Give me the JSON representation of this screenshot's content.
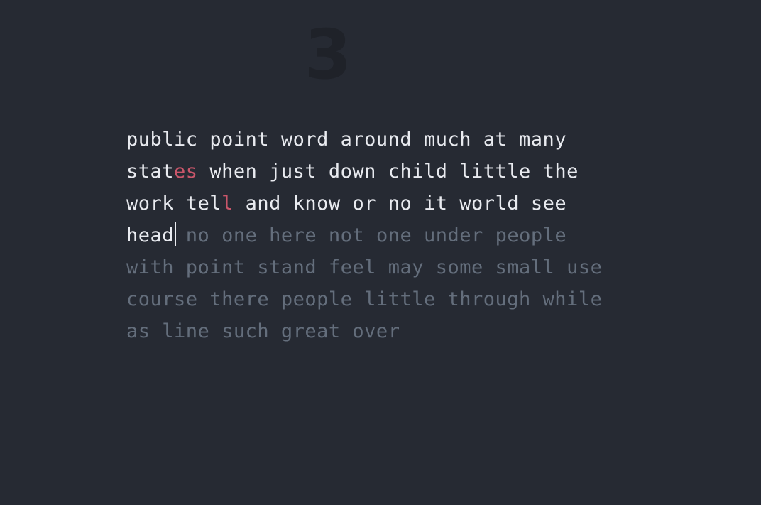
{
  "timer": {
    "value": "3"
  },
  "lines": [
    [
      {
        "parts": [
          {
            "t": "public",
            "s": "done"
          }
        ]
      },
      {
        "parts": [
          {
            "t": "point",
            "s": "done"
          }
        ]
      },
      {
        "parts": [
          {
            "t": "word",
            "s": "done"
          }
        ]
      },
      {
        "parts": [
          {
            "t": "around",
            "s": "done"
          }
        ]
      },
      {
        "parts": [
          {
            "t": "much",
            "s": "done"
          }
        ]
      },
      {
        "parts": [
          {
            "t": "at",
            "s": "done"
          }
        ]
      },
      {
        "parts": [
          {
            "t": "many",
            "s": "done"
          }
        ]
      }
    ],
    [
      {
        "parts": [
          {
            "t": "stat",
            "s": "done"
          },
          {
            "t": "es",
            "s": "err"
          }
        ]
      },
      {
        "parts": [
          {
            "t": "when",
            "s": "done"
          }
        ]
      },
      {
        "parts": [
          {
            "t": "just",
            "s": "done"
          }
        ]
      },
      {
        "parts": [
          {
            "t": "down",
            "s": "done"
          }
        ]
      },
      {
        "parts": [
          {
            "t": "child",
            "s": "done"
          }
        ]
      },
      {
        "parts": [
          {
            "t": "little",
            "s": "done"
          }
        ]
      },
      {
        "parts": [
          {
            "t": "the",
            "s": "done"
          }
        ]
      }
    ],
    [
      {
        "parts": [
          {
            "t": "work",
            "s": "done"
          }
        ]
      },
      {
        "parts": [
          {
            "t": "tel",
            "s": "done"
          },
          {
            "t": "l",
            "s": "err"
          }
        ]
      },
      {
        "parts": [
          {
            "t": "and",
            "s": "done"
          }
        ]
      },
      {
        "parts": [
          {
            "t": "know",
            "s": "done"
          }
        ]
      },
      {
        "parts": [
          {
            "t": "or",
            "s": "done"
          }
        ]
      },
      {
        "parts": [
          {
            "t": "no",
            "s": "done"
          }
        ]
      },
      {
        "parts": [
          {
            "t": "it",
            "s": "done"
          }
        ]
      },
      {
        "parts": [
          {
            "t": "world",
            "s": "done"
          }
        ]
      },
      {
        "parts": [
          {
            "t": "see",
            "s": "done"
          }
        ]
      }
    ],
    [
      {
        "parts": [
          {
            "t": "head",
            "s": "done"
          }
        ],
        "caret": true
      },
      {
        "parts": [
          {
            "t": "no",
            "s": "todo"
          }
        ]
      },
      {
        "parts": [
          {
            "t": "one",
            "s": "todo"
          }
        ]
      },
      {
        "parts": [
          {
            "t": "here",
            "s": "todo"
          }
        ]
      },
      {
        "parts": [
          {
            "t": "not",
            "s": "todo"
          }
        ]
      },
      {
        "parts": [
          {
            "t": "one",
            "s": "todo"
          }
        ]
      },
      {
        "parts": [
          {
            "t": "under",
            "s": "todo"
          }
        ]
      },
      {
        "parts": [
          {
            "t": "people",
            "s": "todo"
          }
        ]
      }
    ],
    [
      {
        "parts": [
          {
            "t": "with",
            "s": "todo"
          }
        ]
      },
      {
        "parts": [
          {
            "t": "point",
            "s": "todo"
          }
        ]
      },
      {
        "parts": [
          {
            "t": "stand",
            "s": "todo"
          }
        ]
      },
      {
        "parts": [
          {
            "t": "feel",
            "s": "todo"
          }
        ]
      },
      {
        "parts": [
          {
            "t": "may",
            "s": "todo"
          }
        ]
      },
      {
        "parts": [
          {
            "t": "some",
            "s": "todo"
          }
        ]
      },
      {
        "parts": [
          {
            "t": "small",
            "s": "todo"
          }
        ]
      },
      {
        "parts": [
          {
            "t": "use",
            "s": "todo"
          }
        ]
      }
    ],
    [
      {
        "parts": [
          {
            "t": "course",
            "s": "todo"
          }
        ]
      },
      {
        "parts": [
          {
            "t": "there",
            "s": "todo"
          }
        ]
      },
      {
        "parts": [
          {
            "t": "people",
            "s": "todo"
          }
        ]
      },
      {
        "parts": [
          {
            "t": "little",
            "s": "todo"
          }
        ]
      },
      {
        "parts": [
          {
            "t": "through",
            "s": "todo"
          }
        ]
      },
      {
        "parts": [
          {
            "t": "while",
            "s": "todo"
          }
        ]
      }
    ],
    [
      {
        "parts": [
          {
            "t": "as",
            "s": "todo"
          }
        ]
      },
      {
        "parts": [
          {
            "t": "line",
            "s": "todo"
          }
        ]
      },
      {
        "parts": [
          {
            "t": "such",
            "s": "todo"
          }
        ]
      },
      {
        "parts": [
          {
            "t": "great",
            "s": "todo"
          }
        ]
      },
      {
        "parts": [
          {
            "t": "over",
            "s": "todo"
          }
        ]
      }
    ]
  ],
  "colors": {
    "background": "#262a33",
    "typed": "#e9ebf0",
    "error": "#c9566a",
    "untyped": "#646e7c",
    "timer": "#1f2229"
  }
}
